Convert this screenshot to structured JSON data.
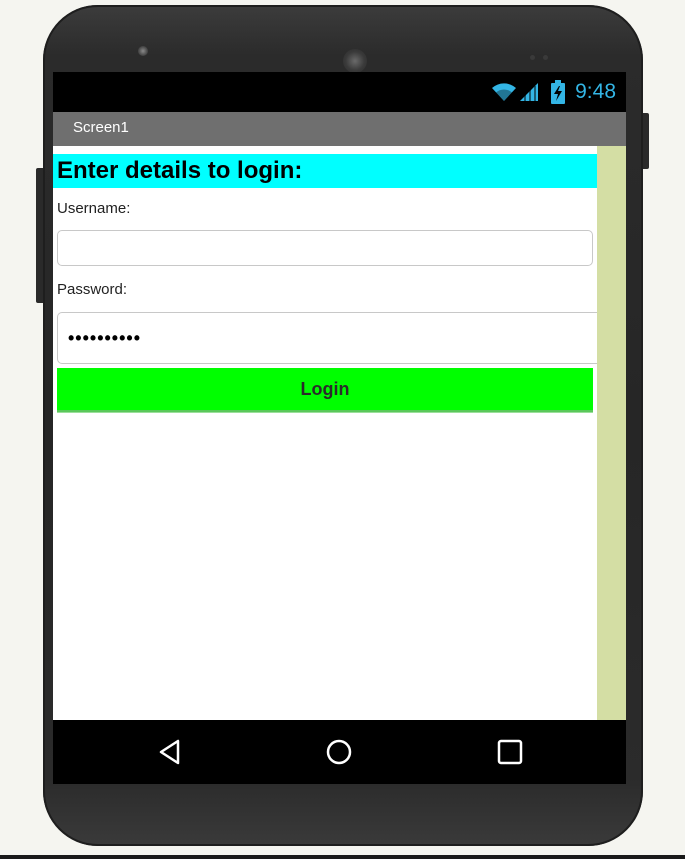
{
  "device": {
    "status_bar": {
      "time": "9:48",
      "icons": [
        "wifi-icon",
        "signal-icon",
        "battery-charging-icon"
      ],
      "icon_color": "#33b5e5"
    },
    "navigation_bar": {
      "buttons": [
        "back-icon",
        "home-icon",
        "recents-icon"
      ]
    }
  },
  "app": {
    "screen_title": "Screen1",
    "title_bar_color": "#6f6f6f",
    "heading": "Enter details to login:",
    "heading_background": "#00ffff",
    "username": {
      "label": "Username:",
      "value": ""
    },
    "password": {
      "label": "Password:",
      "masked_value": "••••••••••"
    },
    "login_button": {
      "label": "Login",
      "background": "#00ff00"
    },
    "scrollbar_color": "#d4dea4"
  }
}
